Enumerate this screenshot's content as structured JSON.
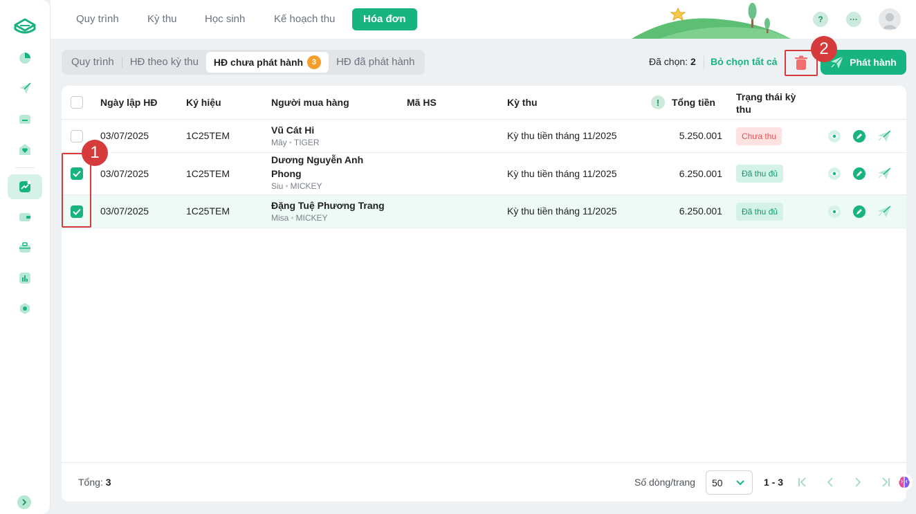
{
  "nav": {
    "tabs": [
      {
        "label": "Quy trình"
      },
      {
        "label": "Kỳ thu"
      },
      {
        "label": "Học sinh"
      },
      {
        "label": "Kế hoạch thu"
      },
      {
        "label": "Hóa đơn"
      }
    ],
    "active_tab": "Hóa đơn",
    "help_icon_label": "?",
    "more_icon_label": "···"
  },
  "subtabs": {
    "items": [
      {
        "label": "Quy trình"
      },
      {
        "label": "HĐ theo kỳ thu"
      },
      {
        "label": "HĐ chưa phát hành",
        "count": "3"
      },
      {
        "label": "HĐ đã phát hành"
      }
    ],
    "active": "HĐ chưa phát hành"
  },
  "selection": {
    "label": "Đã chọn:",
    "count": "2",
    "deselect_label": "Bỏ chọn tất cả",
    "publish_label": "Phát hành"
  },
  "markers": {
    "one": "1",
    "two": "2"
  },
  "table": {
    "columns": {
      "date": "Ngày lập HĐ",
      "symbol": "Ký hiệu",
      "buyer": "Người mua hàng",
      "student_code": "Mã HS",
      "period": "Kỳ thu",
      "total": "Tổng tiền",
      "status": "Trạng thái kỳ thu"
    },
    "rows": [
      {
        "checked": false,
        "date": "03/07/2025",
        "symbol": "1C25TEM",
        "buyer": "Vũ Cát Hi",
        "buyer_nick": "Mây",
        "buyer_class": "TIGER",
        "student_code": "",
        "period": "Kỳ thu tiền tháng 11/2025",
        "total": "5.250.001",
        "status": "Chưa thu"
      },
      {
        "checked": true,
        "date": "03/07/2025",
        "symbol": "1C25TEM",
        "buyer": "Dương Nguyễn Anh Phong",
        "buyer_nick": "Siu",
        "buyer_class": "MICKEY",
        "student_code": "",
        "period": "Kỳ thu tiền tháng 11/2025",
        "total": "6.250.001",
        "status": "Đã thu đủ"
      },
      {
        "checked": true,
        "date": "03/07/2025",
        "symbol": "1C25TEM",
        "buyer": "Đặng Tuệ Phương Trang",
        "buyer_nick": "Misa",
        "buyer_class": "MICKEY",
        "student_code": "",
        "period": "Kỳ thu tiền tháng 11/2025",
        "total": "6.250.001",
        "status": "Đã thu đủ"
      }
    ]
  },
  "footer": {
    "total_label": "Tổng:",
    "total_value": "3",
    "rows_per_page_label": "Số dòng/trang",
    "rows_per_page_value": "50",
    "range": "1 - 3"
  },
  "colors": {
    "accent": "#17b381",
    "danger": "#d63b3b",
    "badge": "#f59e2b"
  }
}
